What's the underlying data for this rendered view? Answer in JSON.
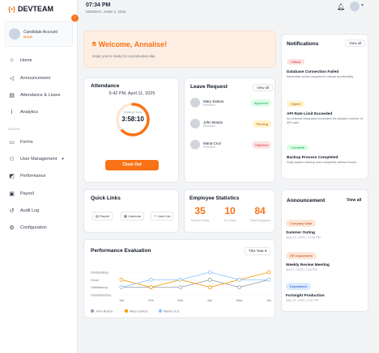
{
  "brand": {
    "name": "DEVTEAM",
    "mark": "{•}"
  },
  "profile": {
    "name": "Candidate Account",
    "role": "Buyer"
  },
  "nav": {
    "home": "Home",
    "announcement": "Announcement",
    "attendance_leave": "Attendance & Leave",
    "analytics": "Analytics",
    "section_admin": "ADMIN",
    "forms": "Forms",
    "user_management": "User Management",
    "performance": "Performance",
    "payroll": "Payroll",
    "audit_log": "Audit Log",
    "configuration": "Configuration"
  },
  "topbar": {
    "time": "07:34 PM",
    "date": "MONDAY, JUNE 2, 2025"
  },
  "welcome": {
    "title": "Welcome, Annalise!",
    "subtitle": "Hope you're ready for a productive day."
  },
  "attendance": {
    "title": "Attendance",
    "datetime": "5:42 PM, April 11, 2025",
    "ring_label": "Working Hours",
    "ring_value": "3:58:10",
    "ring_progress": 0.62,
    "button": "Clock Out"
  },
  "leave": {
    "title": "Leave Request",
    "view_all": "View all",
    "items": [
      {
        "name": "Mary Santos",
        "sub": "Research",
        "status": "Approved"
      },
      {
        "name": "John Bracia",
        "sub": "Research",
        "status": "Pending"
      },
      {
        "name": "Maria Cruz",
        "sub": "Research",
        "status": "Rejected"
      }
    ]
  },
  "quick_links": {
    "title": "Quick Links",
    "items": [
      "Payroll",
      "Calendar",
      "User List"
    ]
  },
  "stats": {
    "title": "Employee Statistics",
    "items": [
      {
        "value": "35",
        "label": "Present Today"
      },
      {
        "value": "10",
        "label": "On Leave"
      },
      {
        "value": "84",
        "label": "Total Employees"
      }
    ]
  },
  "performance": {
    "title": "Performance Evaluation",
    "period": "This Year"
  },
  "chart_data": {
    "type": "line",
    "categories": [
      "Jan",
      "Feb",
      "Mar",
      "Apr",
      "May",
      "Jun"
    ],
    "y_categories": [
      "Unsatisfactory",
      "Satisfactory",
      "Good",
      "Outstanding"
    ],
    "series": [
      {
        "name": "John Bracia",
        "values": [
          1,
          1,
          1,
          2,
          1,
          2
        ],
        "color": "#9ca3af"
      },
      {
        "name": "Mary Santos",
        "values": [
          2,
          1,
          2,
          1,
          2,
          3
        ],
        "color": "#f59e0b"
      },
      {
        "name": "Maria Cruz",
        "values": [
          1,
          2,
          2,
          3,
          2,
          2
        ],
        "color": "#93c5fd"
      }
    ]
  },
  "notifications": {
    "title": "Notifications",
    "view_all": "View all",
    "items": [
      {
        "badge": "Critical",
        "title": "Database Connection Failed",
        "desc": "Immediate action required to restore functionality.",
        "bg": "#fde2e2",
        "fg": "#dc2626"
      },
      {
        "badge": "Urgent",
        "title": "API Rate Limit Exceeded",
        "desc": "An external integration exceeded the allowed number of API calls.",
        "bg": "#fef3c7",
        "fg": "#b45309"
      },
      {
        "badge": "Complete",
        "title": "Backup Process Completed",
        "desc": "Daily system backup was completed without issues.",
        "bg": "#dcfce7",
        "fg": "#16a34a"
      }
    ]
  },
  "announcement": {
    "title": "Announcement",
    "view_all": "View all",
    "items": [
      {
        "tag": "Company Wide",
        "title": "Summer Outing",
        "date": "April 15, 2025 | 12:00 PM"
      },
      {
        "tag": "HR Department",
        "title": "Weekly Review Meeting",
        "date": "April 2, 2025 | 1:00 PM"
      },
      {
        "tag": "Department",
        "title": "Fortnight Production",
        "date": "May 15, 2025 | 2:00 PM"
      }
    ]
  }
}
